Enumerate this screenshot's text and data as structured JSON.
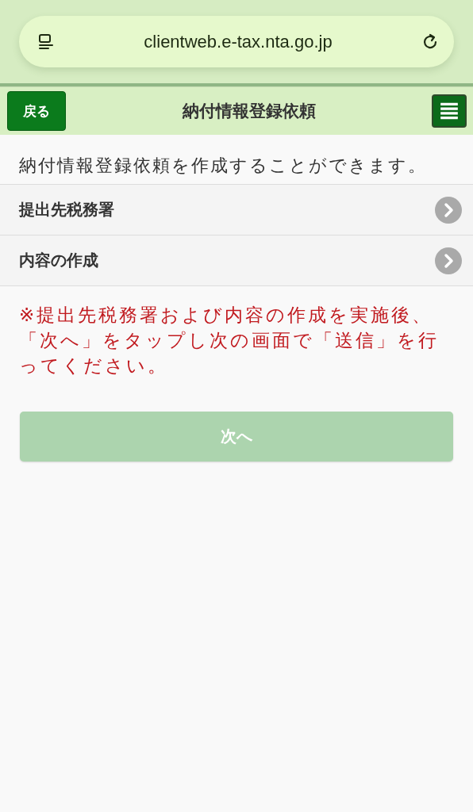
{
  "browser": {
    "url": "clientweb.e-tax.nta.go.jp"
  },
  "header": {
    "back": "戻る",
    "title": "納付情報登録依頼"
  },
  "intro": "納付情報登録依頼を作成することができます。",
  "menu_items": [
    {
      "label": "提出先税務署"
    },
    {
      "label": "内容の作成"
    }
  ],
  "notice": "※提出先税務署および内容の作成を実施後、「次へ」をタップし次の画面で「送信」を行ってください。",
  "next_button": {
    "label": "次へ",
    "disabled": true
  }
}
